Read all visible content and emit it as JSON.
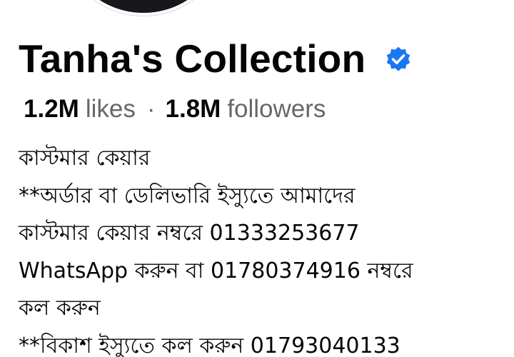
{
  "page": {
    "name": "Tanha's Collection",
    "verified": true,
    "accent_color": "#1877f2"
  },
  "stats": {
    "likes_count": "1.2M",
    "likes_label": "likes",
    "separator": "·",
    "followers_count": "1.8M",
    "followers_label": "followers"
  },
  "bio": {
    "lines": [
      "কাস্টমার কেয়ার",
      "**অর্ডার বা ডেলিভারি ইস্যুতে আমাদের",
      "কাস্টমার কেয়ার নম্বরে  01333253677",
      "WhatsApp করুন বা 01780374916 নম্বরে",
      "কল করুন",
      "**বিকাশ ইস্যুতে কল করুন 01793040133"
    ]
  },
  "icons": {
    "verified_badge": "verified-badge-icon",
    "avatar": "profile-picture"
  }
}
